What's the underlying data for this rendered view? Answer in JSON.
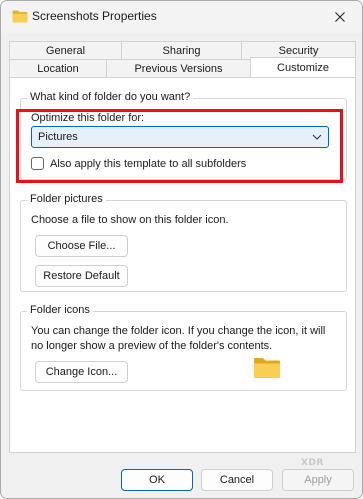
{
  "window": {
    "title": "Screenshots Properties"
  },
  "tabs": {
    "row1": [
      {
        "label": "General"
      },
      {
        "label": "Sharing"
      },
      {
        "label": "Security"
      }
    ],
    "row2": [
      {
        "label": "Location"
      },
      {
        "label": "Previous Versions"
      },
      {
        "label": "Customize",
        "active": true
      }
    ]
  },
  "folder_type": {
    "legend": "What kind of folder do you want?",
    "optimize_label": "Optimize this folder for:",
    "selected_option": "Pictures",
    "apply_subfolders_label": "Also apply this template to all subfolders",
    "apply_subfolders_checked": false
  },
  "folder_pictures": {
    "legend": "Folder pictures",
    "description": "Choose a file to show on this folder icon.",
    "choose_file_label": "Choose File...",
    "restore_default_label": "Restore Default"
  },
  "folder_icons": {
    "legend": "Folder icons",
    "description_line1": "You can change the folder icon. If you change the icon, it will",
    "description_line2": "no longer show a preview of the folder's contents.",
    "change_icon_label": "Change Icon..."
  },
  "footer": {
    "ok_label": "OK",
    "cancel_label": "Cancel",
    "apply_label": "Apply"
  },
  "watermark": "XDR",
  "colors": {
    "highlight_border": "#e8101e",
    "accent": "#0067c0",
    "folder_yellow": "#f5c843"
  }
}
